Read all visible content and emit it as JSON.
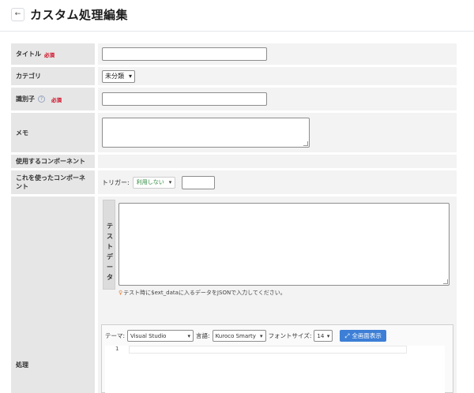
{
  "header": {
    "back_icon": "←",
    "title": "カスタム処理編集"
  },
  "form": {
    "title_label": "タイトル",
    "required_label": "必須",
    "category_label": "カテゴリ",
    "category_value": "未分類",
    "identifier_label": "識別子",
    "help_icon": "?",
    "memo_label": "メモ",
    "components_used_label": "使用するコンポーネント",
    "components_using_label": "これを使ったコンポーネント",
    "trigger_label": "トリガー:",
    "trigger_value": "利用しない",
    "trigger_caret": "▾",
    "test_data_label": "テストデータ",
    "test_data_hint": "テスト時に$ext_dataに入るデータをJSONで入力してください。",
    "process_label": "処理"
  },
  "editor": {
    "theme_label": "テーマ:",
    "theme_value": "Visual Studio",
    "language_label": "言語:",
    "language_value": "Kuroco Smarty",
    "font_size_label": "フォントサイズ:",
    "font_size_value": "14",
    "fullscreen_label": "全画面表示",
    "first_line_number": "1"
  },
  "colors": {
    "required": "#d0021b",
    "fullscreen_button": "#3d7fd6",
    "trigger_text": "#2d8a3e"
  }
}
